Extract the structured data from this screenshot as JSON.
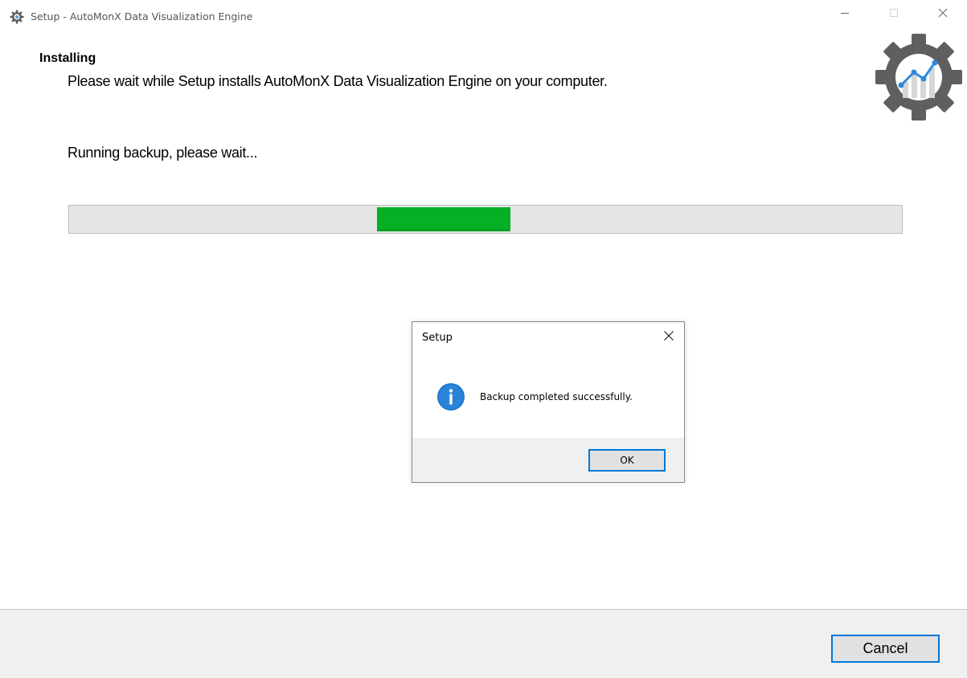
{
  "window": {
    "title": "Setup - AutoMonX Data Visualization Engine",
    "controls": {
      "minimize_icon": "minimize-icon",
      "maximize_icon": "maximize-icon",
      "close_icon": "close-icon"
    }
  },
  "header": {
    "heading": "Installing",
    "description": "Please wait while Setup installs AutoMonX Data Visualization Engine on your computer.",
    "logo_icon": "gear-chart-icon"
  },
  "main": {
    "status_text": "Running backup, please wait...",
    "progress": {
      "style": "marquee",
      "chunk_start": 0.37,
      "chunk_end": 0.53,
      "color": "#06b025"
    }
  },
  "dialog": {
    "title": "Setup",
    "message": "Backup completed successfully.",
    "icon": "info-icon",
    "ok_label": "OK",
    "accent": "#0078d7"
  },
  "footer": {
    "cancel_label": "Cancel"
  }
}
